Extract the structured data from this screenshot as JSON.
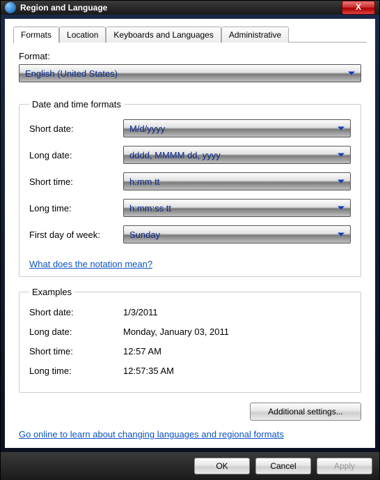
{
  "window": {
    "title": "Region and Language"
  },
  "tabs": {
    "formats": "Formats",
    "location": "Location",
    "keyboards": "Keyboards and Languages",
    "administrative": "Administrative"
  },
  "format": {
    "label": "Format:",
    "value": "English (United States)"
  },
  "datetime": {
    "legend": "Date and time formats",
    "short_date_label": "Short date:",
    "short_date_value": "M/d/yyyy",
    "long_date_label": "Long date:",
    "long_date_value": "dddd, MMMM dd, yyyy",
    "short_time_label": "Short time:",
    "short_time_value": "h:mm tt",
    "long_time_label": "Long time:",
    "long_time_value": "h:mm:ss tt",
    "first_day_label": "First day of week:",
    "first_day_value": "Sunday",
    "notation_link": "What does the notation mean?"
  },
  "examples": {
    "legend": "Examples",
    "short_date_label": "Short date:",
    "short_date_value": "1/3/2011",
    "long_date_label": "Long date:",
    "long_date_value": "Monday, January 03, 2011",
    "short_time_label": "Short time:",
    "short_time_value": "12:57 AM",
    "long_time_label": "Long time:",
    "long_time_value": "12:57:35 AM"
  },
  "buttons": {
    "additional": "Additional settings...",
    "ok": "OK",
    "cancel": "Cancel",
    "apply": "Apply"
  },
  "links": {
    "online": "Go online to learn about changing languages and regional formats"
  }
}
